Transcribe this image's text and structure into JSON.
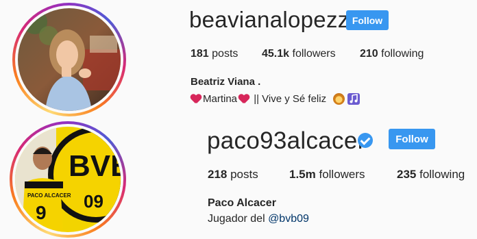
{
  "profiles": [
    {
      "username": "beavianalopezz",
      "follow_label": "Follow",
      "posts_count": "181",
      "posts_label": " posts",
      "followers_count": "45.1k",
      "followers_label": " followers",
      "following_count": "210",
      "following_label": " following",
      "full_name": "Beatriz Viana .",
      "bio": {
        "name": "Martina",
        "rest": " || Vive y Sé feliz "
      }
    },
    {
      "username": "paco93alcacer",
      "verified": true,
      "follow_label": "Follow",
      "posts_count": "218",
      "posts_label": " posts",
      "followers_count": "1.5m",
      "followers_label": " followers",
      "following_count": "235",
      "following_label": " following",
      "full_name": "Paco Alcacer",
      "bio": {
        "text": "Jugador del ",
        "mention": "@bvb09"
      },
      "jersey_name": "PACO ALCACER",
      "jersey_number": "9",
      "logo_letters": "BVB",
      "logo_number": "09"
    }
  ],
  "colors": {
    "follow_button": "#3897f0",
    "verified_badge": "#3897f0",
    "mention": "#003569",
    "text": "#262626",
    "background": "#fafafa"
  }
}
